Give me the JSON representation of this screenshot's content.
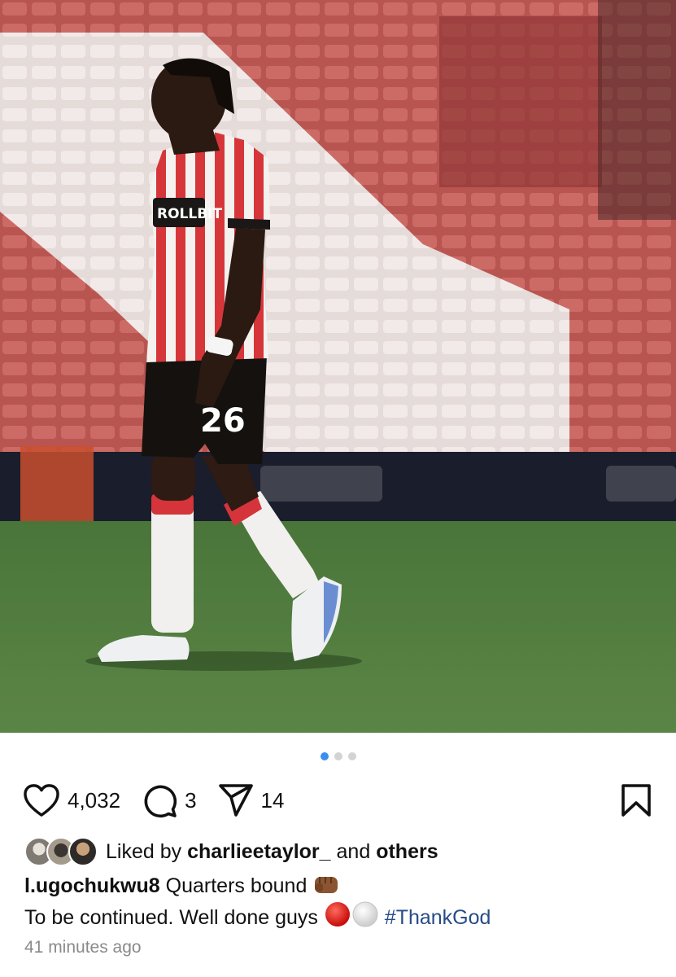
{
  "post": {
    "photo_alt": "Footballer in red and white striped kit number 26 walking on pitch",
    "jersey_number": "26",
    "carousel": {
      "total": 3,
      "active": 1
    },
    "likes_count": "4,032",
    "comments_count": "3",
    "shares_count": "14",
    "liked_by_prefix": "Liked by",
    "liked_by_user": "charlieetaylor_",
    "liked_by_and": "and",
    "liked_by_others": "others",
    "author": "l.ugochukwu8",
    "caption_line1": "Quarters bound",
    "caption_line2": "To be continued. Well done guys",
    "hashtag": "#ThankGod",
    "timestamp": "41 minutes ago"
  },
  "icons": [
    "heart-icon",
    "comment-icon",
    "share-icon",
    "bookmark-icon",
    "fist-emoji",
    "red-circle-emoji",
    "white-circle-emoji"
  ],
  "colors": {
    "active_dot": "#3b8ef0",
    "hashtag": "#274c87",
    "timestamp": "#8a8a8a"
  }
}
